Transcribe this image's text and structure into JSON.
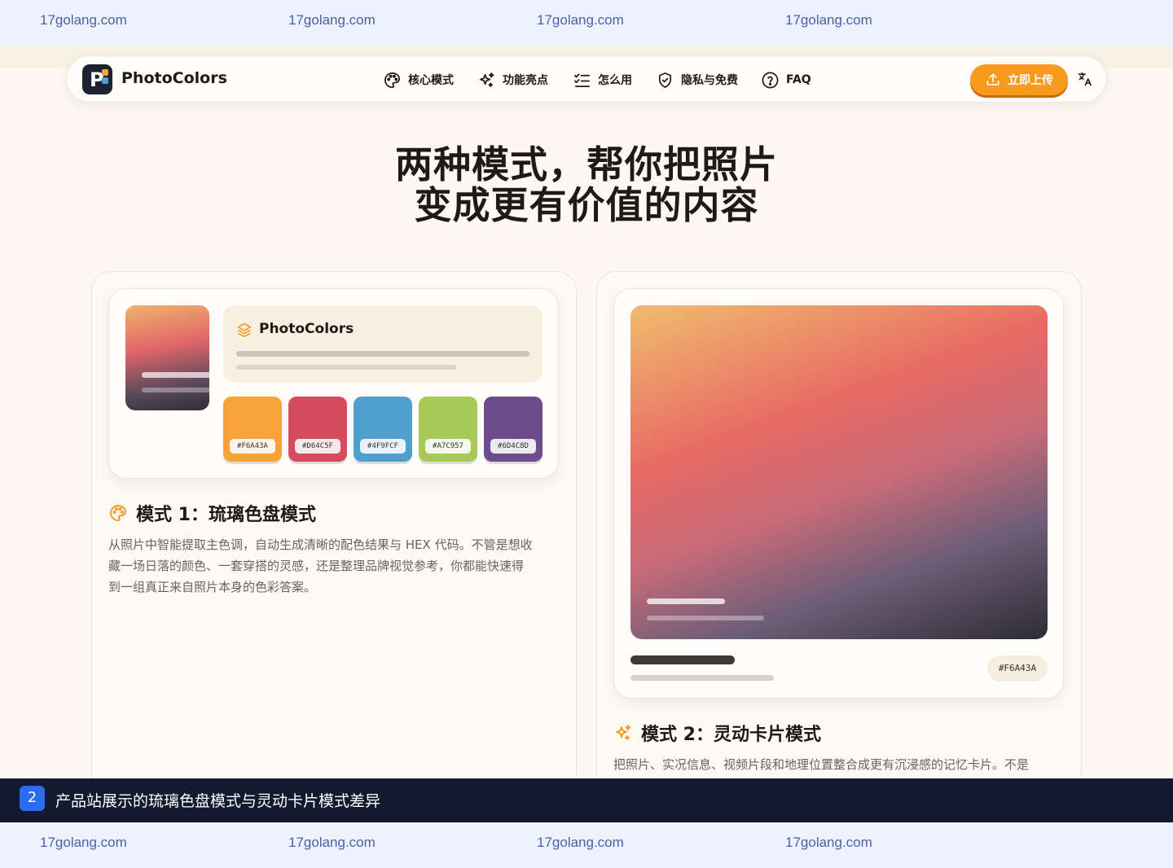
{
  "watermark": {
    "text": [
      "17golang.com",
      "17golang.com",
      "17golang.com",
      "17golang.com"
    ]
  },
  "nav": {
    "brand": "PhotoColors",
    "items": [
      {
        "label": "核心模式",
        "icon": "palette-icon"
      },
      {
        "label": "功能亮点",
        "icon": "sparkles-icon"
      },
      {
        "label": "怎么用",
        "icon": "checklist-icon"
      },
      {
        "label": "隐私与免费",
        "icon": "shield-icon"
      },
      {
        "label": "FAQ",
        "icon": "help-circle-icon"
      }
    ],
    "upload_label": "立即上传",
    "upload_icon": "upload-icon",
    "lang_icon": "translate-icon"
  },
  "hero": {
    "line1": "两种模式，帮你把照片",
    "line2": "变成更有价值的内容"
  },
  "mode1": {
    "panel_title": "PhotoColors",
    "panel_icon": "layers-icon",
    "swatches": [
      {
        "hex": "#F6A43A",
        "color": "#F6A43A"
      },
      {
        "hex": "#D64C5F",
        "color": "#D64C5F"
      },
      {
        "hex": "#4F9FCF",
        "color": "#4F9FCF"
      },
      {
        "hex": "#A7C957",
        "color": "#A7C957"
      },
      {
        "hex": "#6D4C8D",
        "color": "#6D4C8D"
      }
    ],
    "title": "模式 1：琉璃色盘模式",
    "title_icon": "palette-icon",
    "desc": [
      "从照片中智能提取主色调，自动生成清晰的配色结果与 HEX 代码。不管是想收",
      "藏一场日落的颜色、一套穿搭的灵感，还是整理品牌视觉参考，你都能快速得",
      "到一组真正来自照片本身的色彩答案。"
    ]
  },
  "mode2": {
    "hex": "#F6A43A",
    "title": "模式 2：灵动卡片模式",
    "title_icon": "sparkles-icon",
    "desc": [
      "把照片、实况信息、视频片段和地理位置整合成更有沉浸感的记忆卡片。不是"
    ]
  },
  "caption": {
    "number": "2",
    "text": "产品站展示的琉璃色盘模式与灵动卡片模式差异"
  },
  "colors": {
    "accent": "#F79A1E",
    "caption_bg": "#131A30",
    "badge": "#2B6CF0"
  }
}
